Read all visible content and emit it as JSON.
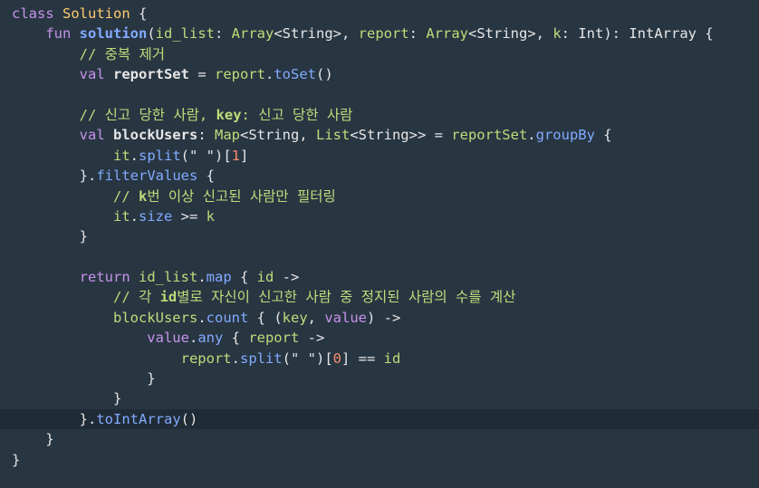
{
  "editor": {
    "colors": {
      "background": "#283642",
      "current_line": "#1f2b35",
      "keyword": "#c792ea",
      "class_name": "#ffcb6b",
      "function": "#82aaff",
      "green": "#bfdc7a",
      "number": "#f78c6c",
      "plain": "#e6e6e6"
    },
    "current_line_index": 20,
    "lines": [
      [
        {
          "t": "class ",
          "c": "kw"
        },
        {
          "t": "Solution",
          "c": "cls"
        },
        {
          "t": " {",
          "c": "pln"
        }
      ],
      [
        {
          "t": "    fun ",
          "c": "kw"
        },
        {
          "t": "solution",
          "c": "fn bold"
        },
        {
          "t": "(",
          "c": "pln"
        },
        {
          "t": "id_list",
          "c": "prm"
        },
        {
          "t": ": ",
          "c": "pln"
        },
        {
          "t": "Array",
          "c": "typ"
        },
        {
          "t": "<String>, ",
          "c": "pln"
        },
        {
          "t": "report",
          "c": "prm"
        },
        {
          "t": ": ",
          "c": "pln"
        },
        {
          "t": "Array",
          "c": "typ"
        },
        {
          "t": "<String>, ",
          "c": "pln"
        },
        {
          "t": "k",
          "c": "prm"
        },
        {
          "t": ": Int): IntArray {",
          "c": "pln"
        }
      ],
      [
        {
          "t": "        // 중복 제거",
          "c": "cmt"
        }
      ],
      [
        {
          "t": "        val ",
          "c": "kw"
        },
        {
          "t": "reportSet",
          "c": "pln bold"
        },
        {
          "t": " = ",
          "c": "pln"
        },
        {
          "t": "report",
          "c": "prm"
        },
        {
          "t": ".",
          "c": "pln"
        },
        {
          "t": "toSet",
          "c": "fn"
        },
        {
          "t": "()",
          "c": "pln"
        }
      ],
      [
        {
          "t": "",
          "c": "pln"
        }
      ],
      [
        {
          "t": "        // 신고 당한 사람, ",
          "c": "cmt"
        },
        {
          "t": "key",
          "c": "cmt bold"
        },
        {
          "t": ": 신고 당한 사람",
          "c": "cmt"
        }
      ],
      [
        {
          "t": "        val ",
          "c": "kw"
        },
        {
          "t": "blockUsers",
          "c": "pln bold"
        },
        {
          "t": ": ",
          "c": "pln"
        },
        {
          "t": "Map",
          "c": "typ"
        },
        {
          "t": "<String, ",
          "c": "pln"
        },
        {
          "t": "List",
          "c": "typ"
        },
        {
          "t": "<String>> = ",
          "c": "pln"
        },
        {
          "t": "reportSet",
          "c": "prm"
        },
        {
          "t": ".",
          "c": "pln"
        },
        {
          "t": "groupBy",
          "c": "fn"
        },
        {
          "t": " {",
          "c": "pln"
        }
      ],
      [
        {
          "t": "            it",
          "c": "prm"
        },
        {
          "t": ".",
          "c": "pln"
        },
        {
          "t": "split",
          "c": "fn"
        },
        {
          "t": "(\" \")[",
          "c": "pln"
        },
        {
          "t": "1",
          "c": "num"
        },
        {
          "t": "]",
          "c": "pln"
        }
      ],
      [
        {
          "t": "        }.",
          "c": "pln"
        },
        {
          "t": "filterValues",
          "c": "fn"
        },
        {
          "t": " {",
          "c": "pln"
        }
      ],
      [
        {
          "t": "            // ",
          "c": "cmt"
        },
        {
          "t": "k",
          "c": "cmt bold"
        },
        {
          "t": "번 이상 신고된 사람만 필터링",
          "c": "cmt"
        }
      ],
      [
        {
          "t": "            it",
          "c": "prm"
        },
        {
          "t": ".",
          "c": "pln"
        },
        {
          "t": "size",
          "c": "fn"
        },
        {
          "t": " >= ",
          "c": "pln"
        },
        {
          "t": "k",
          "c": "prm"
        }
      ],
      [
        {
          "t": "        }",
          "c": "pln"
        }
      ],
      [
        {
          "t": "",
          "c": "pln"
        }
      ],
      [
        {
          "t": "        return ",
          "c": "kw"
        },
        {
          "t": "id_list",
          "c": "prm"
        },
        {
          "t": ".",
          "c": "pln"
        },
        {
          "t": "map",
          "c": "fn"
        },
        {
          "t": " { ",
          "c": "pln"
        },
        {
          "t": "id",
          "c": "prm"
        },
        {
          "t": " ->",
          "c": "pln"
        }
      ],
      [
        {
          "t": "            // 각 ",
          "c": "cmt"
        },
        {
          "t": "id",
          "c": "cmt bold"
        },
        {
          "t": "별로 자신이 신고한 사람 중 정지된 사람의 수를 계산",
          "c": "cmt"
        }
      ],
      [
        {
          "t": "            blockUsers",
          "c": "prm"
        },
        {
          "t": ".",
          "c": "pln"
        },
        {
          "t": "count",
          "c": "fn"
        },
        {
          "t": " { (",
          "c": "pln"
        },
        {
          "t": "key",
          "c": "prm"
        },
        {
          "t": ", ",
          "c": "pln"
        },
        {
          "t": "value",
          "c": "kw"
        },
        {
          "t": ") ->",
          "c": "pln"
        }
      ],
      [
        {
          "t": "                value",
          "c": "kw"
        },
        {
          "t": ".",
          "c": "pln"
        },
        {
          "t": "any",
          "c": "fn"
        },
        {
          "t": " { ",
          "c": "pln"
        },
        {
          "t": "report",
          "c": "prm"
        },
        {
          "t": " ->",
          "c": "pln"
        }
      ],
      [
        {
          "t": "                    report",
          "c": "prm"
        },
        {
          "t": ".",
          "c": "pln"
        },
        {
          "t": "split",
          "c": "fn"
        },
        {
          "t": "(\" \")[",
          "c": "pln"
        },
        {
          "t": "0",
          "c": "num"
        },
        {
          "t": "] == ",
          "c": "pln"
        },
        {
          "t": "id",
          "c": "prm"
        }
      ],
      [
        {
          "t": "                }",
          "c": "pln"
        }
      ],
      [
        {
          "t": "            }",
          "c": "pln"
        }
      ],
      [
        {
          "t": "        }.",
          "c": "pln"
        },
        {
          "t": "toIntArray",
          "c": "fn"
        },
        {
          "t": "()",
          "c": "pln"
        }
      ],
      [
        {
          "t": "    }",
          "c": "pln"
        }
      ],
      [
        {
          "t": "}",
          "c": "pln"
        }
      ]
    ]
  }
}
